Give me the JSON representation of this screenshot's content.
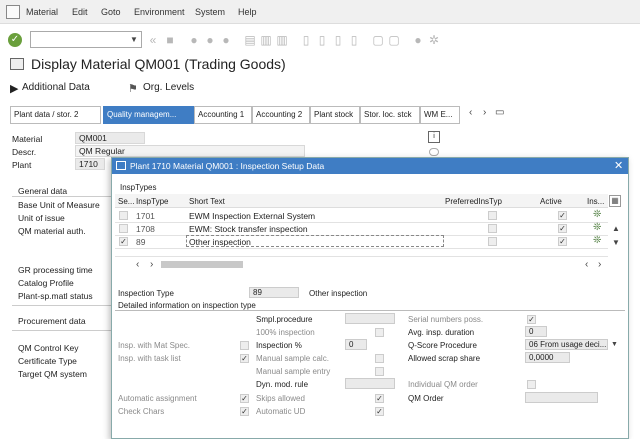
{
  "menu": [
    "Material",
    "Edit",
    "Goto",
    "Environment",
    "System",
    "Help"
  ],
  "title": "Display Material QM001 (Trading Goods)",
  "app_toolbar": {
    "additional_data": "Additional Data",
    "org_levels": "Org. Levels"
  },
  "tabs": [
    "Plant data / stor. 2",
    "Quality managem...",
    "Accounting 1",
    "Accounting 2",
    "Plant stock",
    "Stor. loc. stck",
    "WM E..."
  ],
  "header_fields": {
    "material_label": "Material",
    "material_value": "QM001",
    "descr_label": "Descr.",
    "descr_value": "QM Regular",
    "plant_label": "Plant",
    "plant_value": "1710"
  },
  "left_panel": {
    "general_data": "General data",
    "items1": [
      "Base Unit of Measure",
      "Unit of issue",
      "QM material auth."
    ],
    "items2": [
      "GR processing time",
      "Catalog Profile",
      "Plant-sp.matl status"
    ],
    "procurement_data": "Procurement data",
    "items3": [
      "QM Control Key",
      "Certificate Type",
      "Target QM system"
    ]
  },
  "dialog": {
    "title": "Plant 1710 Material QM001 : Inspection Setup Data",
    "section_label": "InspTypes",
    "columns": {
      "sel": "Se...",
      "insptype": "InspType",
      "short_text": "Short Text",
      "preferred": "PreferredInsTyp",
      "active": "Active",
      "ins": "Ins..."
    },
    "rows": [
      {
        "selected": false,
        "insptype": "1701",
        "short_text": "EWM Inspection External System",
        "preferred": false,
        "active": true
      },
      {
        "selected": false,
        "insptype": "1708",
        "short_text": "EWM: Stock transfer inspection",
        "preferred": false,
        "active": true
      },
      {
        "selected": true,
        "insptype": "89",
        "short_text": "Other inspection",
        "preferred": false,
        "active": true
      }
    ],
    "inspection_type_label": "Inspection Type",
    "inspection_type_value": "89",
    "inspection_type_text": "Other inspection",
    "detail_title": "Detailed information on inspection type",
    "fields": {
      "smpl_procedure": "Smpl.procedure",
      "hundred_inspection": "100% inspection",
      "insp_with_mat_spec": "Insp. with Mat Spec.",
      "insp_with_task_list": "Insp. with task list",
      "inspection_pct": "Inspection %",
      "inspection_pct_value": "0",
      "manual_sample_calc": "Manual sample calc.",
      "manual_sample_entry": "Manual sample entry",
      "dyn_mod_rule": "Dyn. mod. rule",
      "automatic_assignment": "Automatic assignment",
      "skips_allowed": "Skips allowed",
      "check_chars": "Check Chars",
      "automatic_ud": "Automatic UD",
      "serial_numbers_poss": "Serial numbers poss.",
      "avg_insp_duration": "Avg. insp. duration",
      "avg_insp_duration_value": "0",
      "q_score_procedure": "Q-Score Procedure",
      "q_score_procedure_value": "06 From usage deci...",
      "allowed_scrap_share": "Allowed scrap share",
      "allowed_scrap_share_value": "0,0000",
      "individual_qm_order": "Individual QM order",
      "qm_order": "QM Order"
    }
  },
  "colors": {
    "accent": "#3f7dc4",
    "ok_green": "#6a9f3c"
  }
}
